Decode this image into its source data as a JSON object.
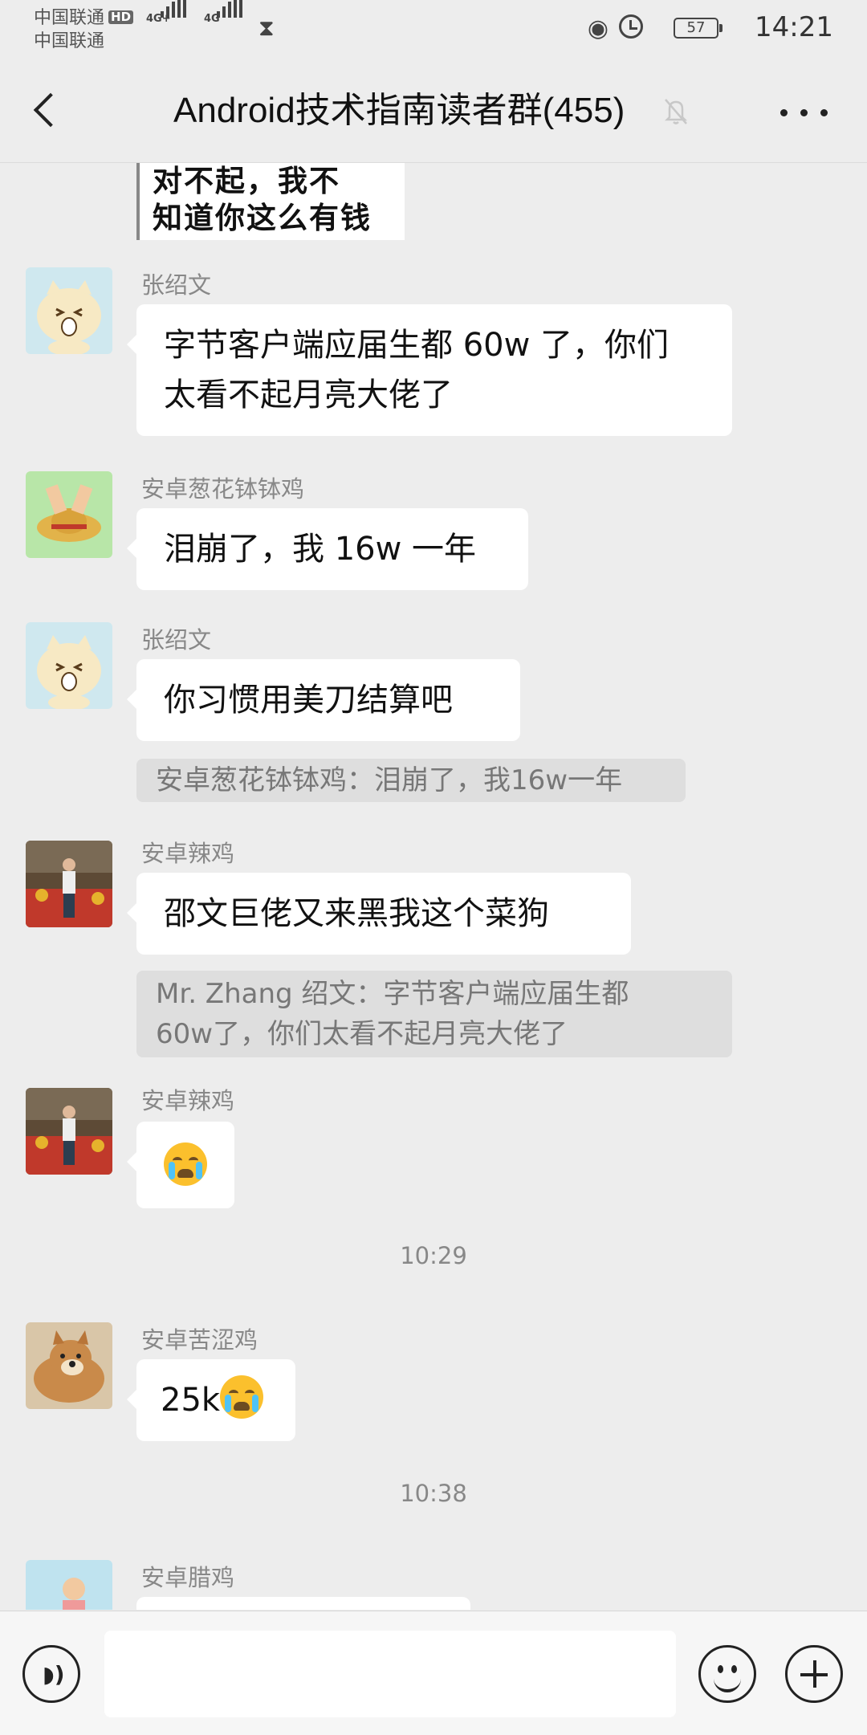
{
  "status_bar": {
    "carrier_1": "中国联通",
    "carrier_2": "中国联通",
    "hd_badge": "HD",
    "network_1": "4G+",
    "network_2": "4G",
    "battery_level": "57",
    "time": "14:21"
  },
  "header": {
    "title": "Android技术指南读者群(455)"
  },
  "chat": {
    "sticker_lines": [
      "对不起，我不",
      "知道你这么有钱"
    ],
    "messages": [
      {
        "sender": "张绍文",
        "text_line_1": "字节客户端应届生都 60w 了，你们",
        "text_line_2": "太看不起月亮大佬了"
      },
      {
        "sender": "安卓葱花钵钵鸡",
        "text": "泪崩了，我 16w 一年"
      },
      {
        "sender": "张绍文",
        "text": "你习惯用美刀结算吧",
        "quote": "安卓葱花钵钵鸡：泪崩了，我16w一年"
      },
      {
        "sender": "安卓辣鸡",
        "text": "邵文巨佬又来黑我这个菜狗",
        "quote_line_1": "Mr. Zhang 绍文：字节客户端应届生都",
        "quote_line_2": "60w了，你们太看不起月亮大佬了"
      },
      {
        "sender": "安卓辣鸡",
        "emoji": "crying-face"
      },
      {
        "timestamp": "10:29"
      },
      {
        "sender": "安卓苦涩鸡",
        "text": "25k",
        "emoji": "crying-face"
      },
      {
        "timestamp": "10:38"
      },
      {
        "sender": "安卓腊鸡"
      }
    ]
  },
  "colors": {
    "background": "#ededed",
    "bubble": "#ffffff",
    "quote_background": "#dedede",
    "secondary_text": "#888888"
  }
}
